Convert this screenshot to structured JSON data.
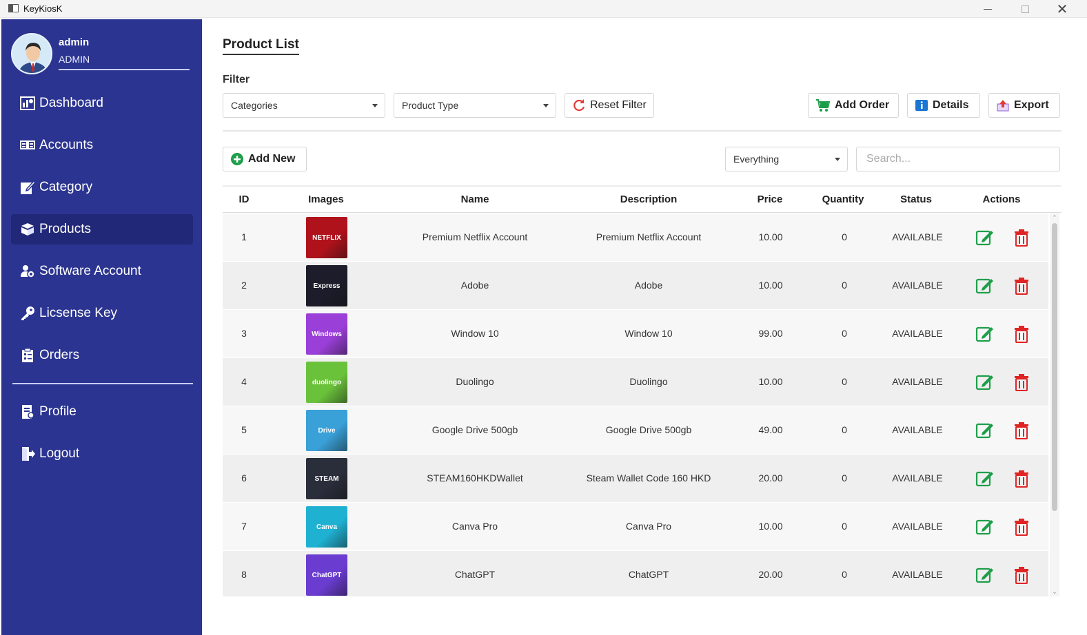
{
  "window": {
    "title": "KeyKiosK"
  },
  "user": {
    "name": "admin",
    "role": "ADMIN"
  },
  "sidebar": {
    "items": [
      {
        "label": "Dashboard",
        "icon": "dashboard-icon"
      },
      {
        "label": "Accounts",
        "icon": "accounts-icon"
      },
      {
        "label": "Category",
        "icon": "category-icon"
      },
      {
        "label": "Products",
        "icon": "products-icon",
        "active": true
      },
      {
        "label": "Software Account",
        "icon": "users-icon"
      },
      {
        "label": "Licsense Key",
        "icon": "key-icon"
      },
      {
        "label": "Orders",
        "icon": "orders-icon"
      }
    ],
    "bottom_items": [
      {
        "label": "Profile",
        "icon": "profile-icon"
      },
      {
        "label": "Logout",
        "icon": "logout-icon"
      }
    ]
  },
  "main": {
    "title": "Product List",
    "filter_label": "Filter",
    "categories_select": "Categories",
    "product_type_select": "Product Type",
    "reset_filter": "Reset Filter",
    "add_order": "Add Order",
    "details": "Details",
    "export": "Export",
    "add_new": "Add New",
    "search_scope": "Everything",
    "search_placeholder": "Search..."
  },
  "table": {
    "columns": [
      "ID",
      "Images",
      "Name",
      "Description",
      "Price",
      "Quantity",
      "Status",
      "Actions"
    ],
    "rows": [
      {
        "id": "1",
        "name": "Premium Netflix Account",
        "description": "Premium Netflix Account",
        "price": "10.00",
        "quantity": "0",
        "status": "AVAILABLE",
        "thumb_color": "#b0121b",
        "thumb_text": "NETFLIX"
      },
      {
        "id": "2",
        "name": "Adobe",
        "description": "Adobe",
        "price": "10.00",
        "quantity": "0",
        "status": "AVAILABLE",
        "thumb_color": "#1c1c2a",
        "thumb_text": "Express"
      },
      {
        "id": "3",
        "name": "Window 10",
        "description": "Window 10",
        "price": "99.00",
        "quantity": "0",
        "status": "AVAILABLE",
        "thumb_color": "#9a3fd8",
        "thumb_text": "Windows"
      },
      {
        "id": "4",
        "name": "Duolingo",
        "description": "Duolingo",
        "price": "10.00",
        "quantity": "0",
        "status": "AVAILABLE",
        "thumb_color": "#6ac23b",
        "thumb_text": "duolingo"
      },
      {
        "id": "5",
        "name": "Google Drive 500gb",
        "description": "Google Drive 500gb",
        "price": "49.00",
        "quantity": "0",
        "status": "AVAILABLE",
        "thumb_color": "#3aa0d8",
        "thumb_text": "Drive"
      },
      {
        "id": "6",
        "name": "STEAM160HKDWallet",
        "description": "Steam Wallet Code 160 HKD",
        "price": "20.00",
        "quantity": "0",
        "status": "AVAILABLE",
        "thumb_color": "#2a2d3a",
        "thumb_text": "STEAM"
      },
      {
        "id": "7",
        "name": "Canva Pro",
        "description": "Canva Pro",
        "price": "10.00",
        "quantity": "0",
        "status": "AVAILABLE",
        "thumb_color": "#1fb1d2",
        "thumb_text": "Canva"
      },
      {
        "id": "8",
        "name": "ChatGPT",
        "description": "ChatGPT",
        "price": "20.00",
        "quantity": "0",
        "status": "AVAILABLE",
        "thumb_color": "#6a3cd0",
        "thumb_text": "ChatGPT"
      }
    ]
  },
  "colors": {
    "sidebar": "#2b3490",
    "sidebar_active": "#212878",
    "edit": "#1e9e4a",
    "delete": "#e02424",
    "add_new": "#1e9e4a"
  }
}
